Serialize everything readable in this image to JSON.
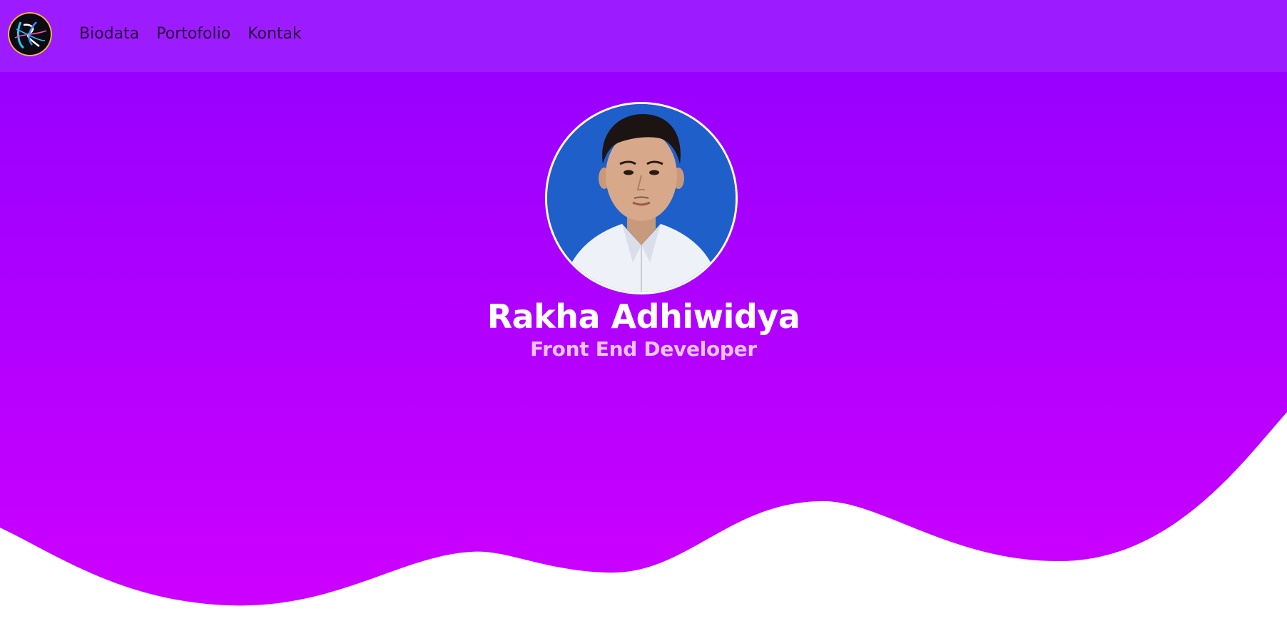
{
  "nav": {
    "logo_icon": "rk-monogram-logo",
    "links": [
      {
        "label": "Biodata"
      },
      {
        "label": "Portofolio"
      },
      {
        "label": "Kontak"
      }
    ]
  },
  "hero": {
    "name": "Rakha Adhiwidya",
    "role": "Front End Developer",
    "photo_icon": "profile-portrait"
  },
  "colors": {
    "navbar": "#9c1cff",
    "hero_top": "#9500ff",
    "hero_bottom": "#cc00ff",
    "nav_text": "#2a0d3d",
    "name_text": "#ffffff",
    "role_text": "#efc4ff",
    "page_bg": "#ffffff"
  }
}
